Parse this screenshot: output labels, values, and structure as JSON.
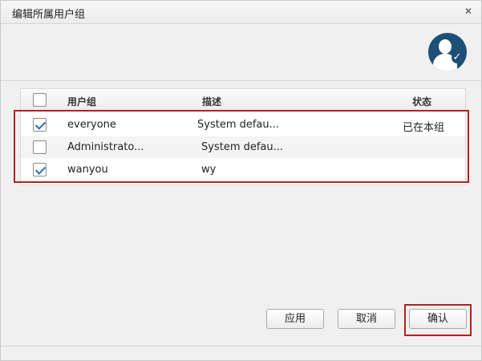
{
  "dialog": {
    "title": "编辑所属用户组",
    "close_icon": "close-icon"
  },
  "avatar": {
    "icon": "user-check-icon",
    "badge_glyph": "✓"
  },
  "table": {
    "headers": {
      "group": "用户组",
      "description": "描述",
      "status": "状态"
    },
    "rows": [
      {
        "checked": true,
        "group": "everyone",
        "description": "System defau...",
        "status": "已在本组"
      },
      {
        "checked": false,
        "group": "Administrato...",
        "description": "System defau...",
        "status": ""
      },
      {
        "checked": true,
        "group": "wanyou",
        "description": "wy",
        "status": ""
      }
    ]
  },
  "buttons": {
    "apply": "应用",
    "cancel": "取消",
    "confirm": "确认"
  },
  "colors": {
    "highlight": "#b22222",
    "avatar_bg": "#1d4f77",
    "check": "#2c6fb8"
  }
}
